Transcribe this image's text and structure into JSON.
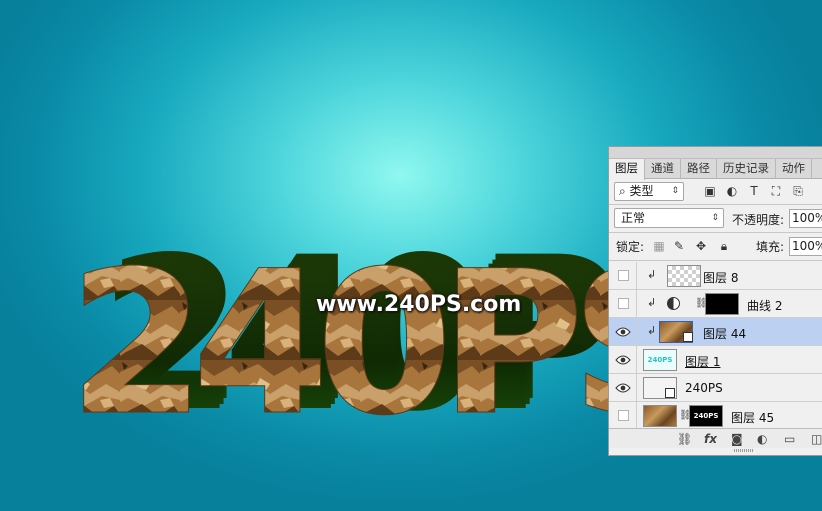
{
  "canvas": {
    "art_text": "240PS",
    "watermark": "www.240PS.com"
  },
  "panel": {
    "tabs": [
      "图层",
      "通道",
      "路径",
      "历史记录",
      "动作"
    ],
    "filter": {
      "label": "类型",
      "search_icon": "search-icon"
    },
    "blend_mode": "正常",
    "opacity_label": "不透明度:",
    "opacity_value": "100%",
    "lock_label": "锁定:",
    "fill_label": "填充:",
    "fill_value": "100%",
    "layers": [
      {
        "name": "图层 8",
        "visible": false,
        "selected": false,
        "clipped": true
      },
      {
        "name": "曲线 2",
        "visible": false,
        "selected": false,
        "clipped": true
      },
      {
        "name": "图层 44",
        "visible": true,
        "selected": true,
        "clipped": true
      },
      {
        "name": "图层 1",
        "visible": true,
        "selected": false,
        "clipped": false
      },
      {
        "name": "240PS",
        "visible": true,
        "selected": false,
        "clipped": false
      },
      {
        "name": "图层 45",
        "visible": false,
        "selected": false,
        "clipped": false
      }
    ],
    "thumb_texts": {
      "layer1": "240PS",
      "layer45_mask": "240PS"
    }
  }
}
